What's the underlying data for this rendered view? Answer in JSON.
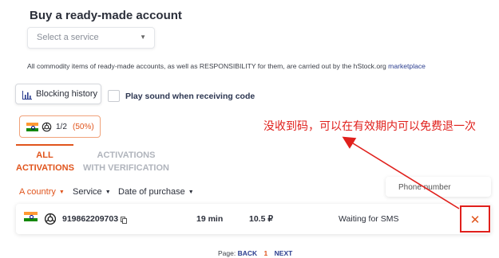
{
  "header": {
    "title": "Buy a ready-made account"
  },
  "service_select": {
    "placeholder": "Select a service"
  },
  "notice": {
    "text": "All commodity items of ready-made accounts, as well as RESPONSIBILITY for them, are carried out by the hStock.org ",
    "link": "marketplace"
  },
  "toolbar": {
    "blocking_history": "Blocking history",
    "play_sound": "Play sound when receiving code",
    "play_sound_checked": false
  },
  "chip": {
    "count": "1/2",
    "percent": "(50%)",
    "flag": "india-flag-icon",
    "service_icon": "openai-icon"
  },
  "annotation": {
    "text": "没收到码，可以在有效期内可以免费退一次",
    "color": "#e0201c"
  },
  "tabs": [
    {
      "line1": "ALL",
      "line2": "ACTIVATIONS",
      "active": true
    },
    {
      "line1": "ACTIVATIONS",
      "line2": "WITH VERIFICATION",
      "active": false
    }
  ],
  "filters": {
    "country": "A country",
    "service": "Service",
    "date": "Date of purchase"
  },
  "phone_search": {
    "placeholder": "Phone number"
  },
  "activations": [
    {
      "phone": "919862209703",
      "time": "19 min",
      "price": "10.5 ₽",
      "status": "Waiting for SMS",
      "cancel": "✕"
    }
  ],
  "pagination": {
    "label": "Page:",
    "back": "BACK",
    "current": "1",
    "next": "NEXT"
  },
  "colors": {
    "accent": "#e0541c",
    "link": "#2a3d8f",
    "annotation": "#e0201c"
  }
}
